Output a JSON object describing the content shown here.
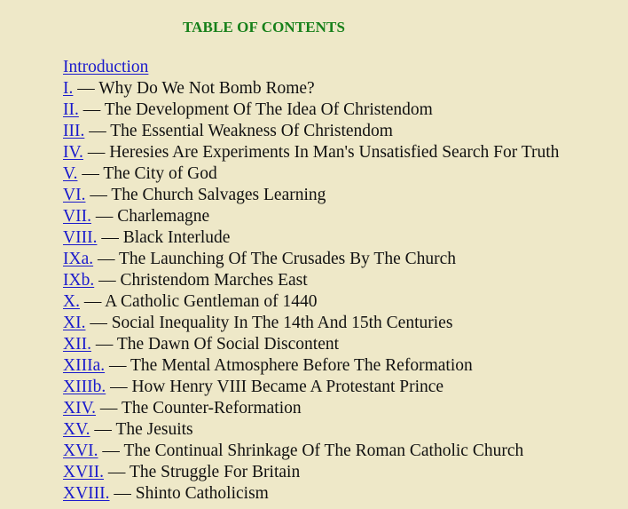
{
  "title": "TABLE OF CONTENTS",
  "colors": {
    "background": "#EEE8C8",
    "title": "#17801a",
    "link": "#1a1acc",
    "text": "#111111"
  },
  "separator": " — ",
  "entries": [
    {
      "link": "Introduction",
      "title": ""
    },
    {
      "link": "I.",
      "title": "Why Do We Not Bomb Rome?"
    },
    {
      "link": "II.",
      "title": "The Development Of The Idea Of Christendom"
    },
    {
      "link": "III.",
      "title": "The Essential Weakness Of Christendom"
    },
    {
      "link": "IV.",
      "title": "Heresies Are Experiments In Man's Unsatisfied Search For Truth"
    },
    {
      "link": "V.",
      "title": "The City of God"
    },
    {
      "link": "VI.",
      "title": "The Church Salvages Learning"
    },
    {
      "link": "VII.",
      "title": "Charlemagne"
    },
    {
      "link": "VIII.",
      "title": "Black Interlude"
    },
    {
      "link": "IXa.",
      "title": "The Launching Of The Crusades By The Church"
    },
    {
      "link": "IXb.",
      "title": "Christendom Marches East"
    },
    {
      "link": "X.",
      "title": "A Catholic Gentleman of 1440"
    },
    {
      "link": "XI.",
      "title": "Social Inequality In The 14th And 15th Centuries"
    },
    {
      "link": "XII.",
      "title": "The Dawn Of Social Discontent"
    },
    {
      "link": "XIIIa.",
      "title": "The Mental Atmosphere Before The Reformation"
    },
    {
      "link": "XIIIb.",
      "title": "How Henry VIII Became A Protestant Prince"
    },
    {
      "link": "XIV.",
      "title": "The Counter-Reformation"
    },
    {
      "link": "XV.",
      "title": "The Jesuits"
    },
    {
      "link": "XVI.",
      "title": "The Continual Shrinkage Of The Roman Catholic Church"
    },
    {
      "link": "XVII.",
      "title": "The Struggle For Britain"
    },
    {
      "link": "XVIII.",
      "title": "Shinto Catholicism"
    }
  ]
}
